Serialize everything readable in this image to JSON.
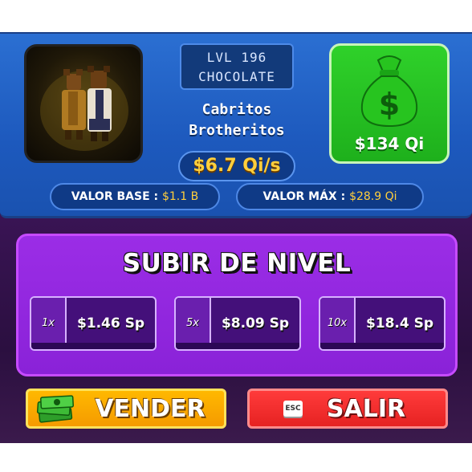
{
  "brainrot": {
    "level_line": "LVL 196",
    "mutation": "CHOCOLATE",
    "name_line1": "Cabritos",
    "name_line2": "Brotheritos",
    "rate": "$6.7 Qi/s",
    "sell_value": "$134 Qi",
    "base_value_label": "VALOR BASE :",
    "base_value": "$1.1 B",
    "max_value_label": "VALOR MÁX :",
    "max_value": "$28.9 Qi"
  },
  "upgrade": {
    "title": "SUBIR DE NIVEL",
    "options": [
      {
        "multiplier": "1x",
        "price": "$1.46 Sp"
      },
      {
        "multiplier": "5x",
        "price": "$8.09 Sp"
      },
      {
        "multiplier": "10x",
        "price": "$18.4 Sp"
      }
    ]
  },
  "actions": {
    "sell_label": "VENDER",
    "exit_label": "SALIR",
    "exit_key": "ESC"
  },
  "icons": {
    "money_bag": "money-bag-icon",
    "cash_stack": "cash-stack-icon",
    "esc_key": "esc-key-icon"
  },
  "colors": {
    "panel_blue": "#1d59bd",
    "money_green": "#1eb01c",
    "upgrade_purple": "#8a22d8",
    "sell_orange": "#f59b00",
    "exit_red": "#e62222",
    "gold_text": "#ffcf3c"
  }
}
